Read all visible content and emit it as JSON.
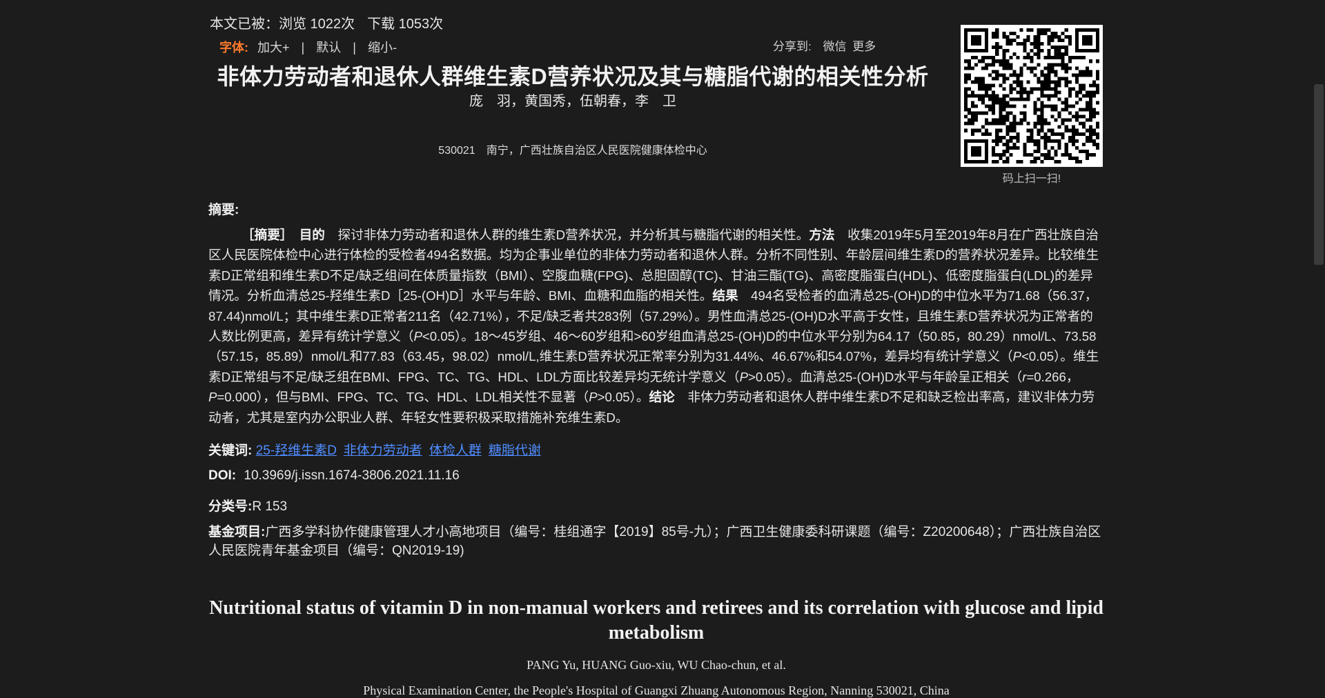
{
  "stats": {
    "prefix": "本文已被：",
    "views": "浏览 1022次",
    "downloads": "下载 1053次"
  },
  "fontbar": {
    "label": "字体:",
    "increase": "加大+",
    "default": "默认",
    "decrease": "缩小-",
    "sep": "|"
  },
  "share": {
    "label": "分享到:",
    "wechat": "微信",
    "more": "更多"
  },
  "title_cn": "非体力劳动者和退休人群维生素D营养状况及其与糖脂代谢的相关性分析",
  "authors_cn": "庞　羽，黄国秀，伍朝春，李　卫",
  "affil_cn": "530021　南宁，广西壮族自治区人民医院健康体检中心",
  "qr_caption": "码上扫一扫!",
  "abstract": {
    "heading": "摘要:",
    "lead": "［摘要］",
    "obj_label": "目的",
    "obj_text": "探讨非体力劳动者和退休人群的维生素D营养状况，并分析其与糖脂代谢的相关性。",
    "method_label": "方法",
    "method_text": "收集2019年5月至2019年8月在广西壮族自治区人民医院体检中心进行体检的受检者494名数据。均为企事业单位的非体力劳动者和退休人群。分析不同性别、年龄层间维生素D的营养状况差异。比较维生素D正常组和维生素D不足/缺乏组间在体质量指数（BMI）、空腹血糖(FPG)、总胆固醇(TC)、甘油三酯(TG)、高密度脂蛋白(HDL)、低密度脂蛋白(LDL)的差异情况。分析血清总25-羟维生素D［25-(OH)D］水平与年龄、BMI、血糖和血脂的相关性。",
    "result_label": "结果",
    "result_text_1": "494名受检者的血清总25-(OH)D的中位水平为71.68（56.37，87.44)nmol/L；其中维生素D正常者211名（42.71%），不足/缺乏者共283例（57.29%）。男性血清总25-(OH)D水平高于女性，且维生素D营养状况为正常者的人数比例更高，差异有统计学意义（",
    "p_italic": "P",
    "result_text_2": "<0.05）。18～45岁组、46～60岁组和>60岁组血清总25-(OH)D的中位水平分别为64.17（50.85，80.29）nmol/L、73.58（57.15，85.89）nmol/L和77.83（63.45，98.02）nmol/L,维生素D营养状况正常率分别为31.44%、46.67%和54.07%，差异均有统计学意义（",
    "result_text_3": "<0.05）。维生素D正常组与不足/缺乏组在BMI、FPG、TC、TG、HDL、LDL方面比较差异均无统计学意义（",
    "result_text_4": ">0.05）。血清总25-(OH)D水平与年龄呈正相关（",
    "r_italic": "r",
    "result_text_5": "=0.266，",
    "result_text_6": "=0.000），但与BMI、FPG、TC、TG、HDL、LDL相关性不显著（",
    "result_text_7": ">0.05）。",
    "concl_label": "结论",
    "concl_text": "非体力劳动者和退休人群中维生素D不足和缺乏检出率高，建议非体力劳动者，尤其是室内办公职业人群、年轻女性要积极采取措施补充维生素D。"
  },
  "keywords": {
    "label": "关键词:",
    "items": [
      "25-羟维生素D",
      "非体力劳动者",
      "体检人群",
      "糖脂代谢"
    ]
  },
  "doi": {
    "label": "DOI:",
    "value": "10.3969/j.issn.1674-3806.2021.11.16"
  },
  "class_no": {
    "label": "分类号:",
    "value": "R 153"
  },
  "fund": {
    "label": "基金项目:",
    "value": "广西多学科协作健康管理人才小高地项目（编号：桂组通字【2019】85号-九）；广西卫生健康委科研课题（编号：Z20200648）；广西壮族自治区人民医院青年基金项目（编号：QN2019-19)"
  },
  "title_en": "Nutritional status of vitamin D in non-manual workers and retirees and its correlation with glucose and lipid metabolism",
  "authors_en": "PANG Yu, HUANG Guo-xiu, WU Chao-chun, et al.",
  "affil_en": "Physical Examination Center, the People's Hospital of Guangxi Zhuang Autonomous Region, Nanning 530021, China"
}
